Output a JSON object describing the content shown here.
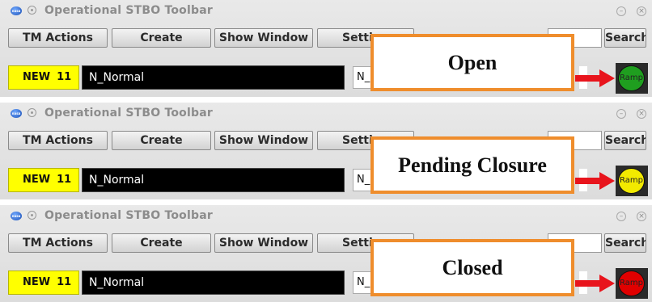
{
  "toolbar": {
    "window_title": "Operational STBO Toolbar",
    "app_icon_text": "nasa",
    "buttons": [
      "TM Actions",
      "Create",
      "Show Window",
      "Setti"
    ],
    "search_label": "Search"
  },
  "panels": [
    {
      "status_label": "NEW",
      "status_count": "11",
      "plan_name": "N_Normal",
      "secondary_field": "N_",
      "callout_text": "Open",
      "ramp_label": "Ramp",
      "ramp_status": "open",
      "ramp_color": "#1f9e1f"
    },
    {
      "status_label": "NEW",
      "status_count": "11",
      "plan_name": "N_Normal",
      "secondary_field": "N_",
      "callout_text": "Pending Closure",
      "ramp_label": "Ramp",
      "ramp_status": "pending-closure",
      "ramp_color": "#f2ea00"
    },
    {
      "status_label": "NEW",
      "status_count": "11",
      "plan_name": "N_Normal",
      "secondary_field": "N_(",
      "callout_text": "Closed",
      "ramp_label": "Ramp",
      "ramp_status": "closed",
      "ramp_color": "#e00000"
    }
  ],
  "colors": {
    "callout_border": "#ef8d2c",
    "arrow": "#e8141c",
    "status_badge": "#ffff00"
  }
}
